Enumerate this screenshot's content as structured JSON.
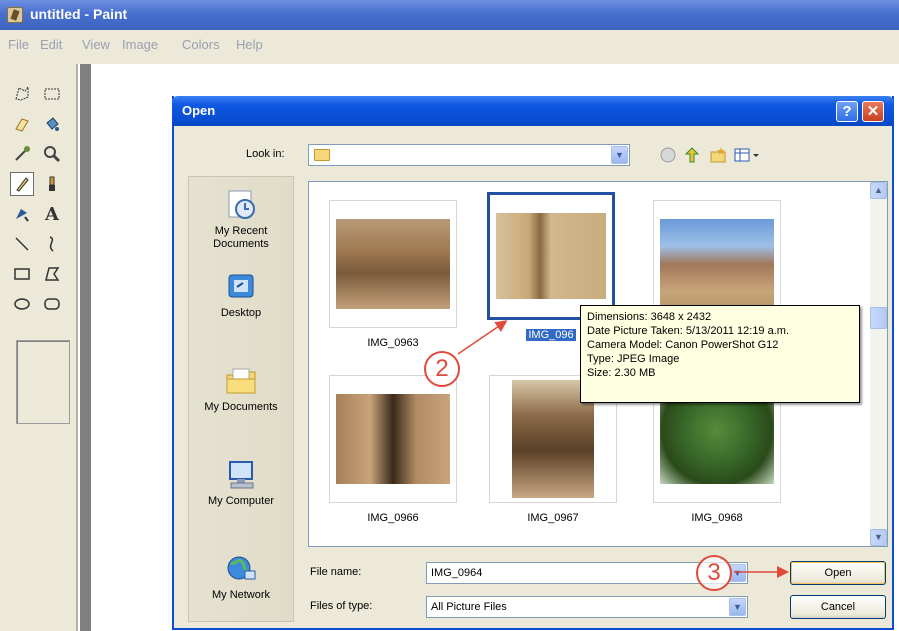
{
  "paint": {
    "title": "untitled - Paint",
    "menu": [
      "File",
      "Edit",
      "View",
      "Image",
      "Colors",
      "Help"
    ],
    "tools": [
      "free-form-select-icon",
      "rectangle-select-icon",
      "eraser-icon",
      "fill-icon",
      "pick-color-icon",
      "magnifier-icon",
      "pencil-icon",
      "brush-icon",
      "airbrush-icon",
      "text-icon",
      "line-icon",
      "curve-icon",
      "rectangle-icon",
      "polygon-icon",
      "ellipse-icon",
      "rounded-rectangle-icon"
    ]
  },
  "dialog": {
    "title": "Open",
    "help_label": "?",
    "close_label": "✕",
    "look_in_label": "Look in:",
    "places": [
      {
        "label": "My Recent Documents",
        "icon": "recent-documents-icon"
      },
      {
        "label": "Desktop",
        "icon": "desktop-icon"
      },
      {
        "label": "My Documents",
        "icon": "my-documents-icon"
      },
      {
        "label": "My Computer",
        "icon": "my-computer-icon"
      },
      {
        "label": "My Network",
        "icon": "my-network-icon"
      }
    ],
    "files": [
      {
        "name": "IMG_0963",
        "selected": false
      },
      {
        "name": "IMG_0964",
        "selected": true
      },
      {
        "name": "",
        "selected": false
      },
      {
        "name": "IMG_0966",
        "selected": false
      },
      {
        "name": "IMG_0967",
        "selected": false
      },
      {
        "name": "IMG_0968",
        "selected": false
      }
    ],
    "selected_label_visible": "IMG_096",
    "tooltip": {
      "dimensions": "Dimensions: 3648 x 2432",
      "date_taken": "Date Picture Taken: 5/13/2011 12:19 a.m.",
      "camera": "Camera Model: Canon PowerShot G12",
      "type": "Type: JPEG Image",
      "size": "Size: 2.30 MB"
    },
    "file_name_label": "File name:",
    "file_name_value": "IMG_0964",
    "files_of_type_label": "Files of type:",
    "files_of_type_value": "All Picture Files",
    "open_button": "Open",
    "cancel_button": "Cancel"
  },
  "annotations": {
    "step2": "2",
    "step3": "3",
    "color": "#e04a3a"
  }
}
